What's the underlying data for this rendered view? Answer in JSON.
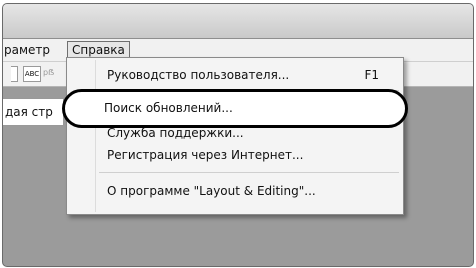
{
  "menubar": {
    "partial_item": "раметр",
    "active_item": "Справка"
  },
  "toolbar": {
    "abc_label": "ABC",
    "icon3_text": "pẞ"
  },
  "left_field": {
    "text": "дая стр"
  },
  "dropdown": {
    "items": [
      {
        "label": "Руководство пользователя...",
        "shortcut": "F1"
      },
      {
        "label": "Поиск обновлений..."
      },
      {
        "label": "Служба поддержки..."
      },
      {
        "label": "Регистрация через Интернет..."
      },
      {
        "label": "О программе \"Layout & Editing\"..."
      }
    ]
  }
}
